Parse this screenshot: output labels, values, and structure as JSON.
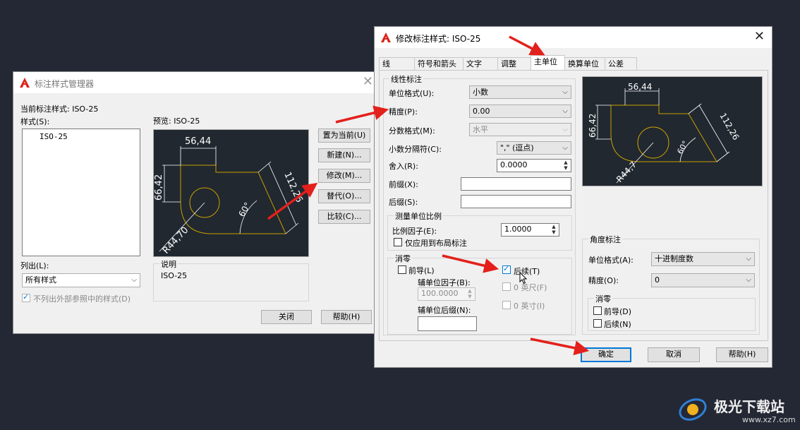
{
  "manager": {
    "title": "标注样式管理器",
    "current_style_label": "当前标注样式: ISO-25",
    "styles_label": "样式(S):",
    "styles": [
      "ISO-25"
    ],
    "preview_label": "预览: ISO-25",
    "list_label": "列出(L):",
    "list_value": "所有样式",
    "exclude_xref_label": "不列出外部参照中的样式(D)",
    "description_label": "说明",
    "description_value": "ISO-25",
    "buttons": {
      "set_current": "置为当前(U)",
      "new": "新建(N)...",
      "modify": "修改(M)...",
      "override": "替代(O)...",
      "compare": "比较(C)...",
      "close": "关闭",
      "help": "帮助(H)"
    },
    "preview_dims": {
      "width": "56,44",
      "height": "66,42",
      "diag": "112,26",
      "radius": "R44,70",
      "angle": "60°"
    }
  },
  "modify": {
    "title": "修改标注样式: ISO-25",
    "tabs": [
      "线",
      "符号和箭头",
      "文字",
      "调整",
      "主单位",
      "换算单位",
      "公差"
    ],
    "active_tab": "主单位",
    "linear": {
      "group_label": "线性标注",
      "unit_format_label": "单位格式(U):",
      "unit_format_value": "小数",
      "precision_label": "精度(P):",
      "precision_value": "0.00",
      "fraction_label": "分数格式(M):",
      "fraction_value": "水平",
      "decimal_sep_label": "小数分隔符(C):",
      "decimal_sep_value": "\",\" (逗点)",
      "round_label": "舍入(R):",
      "round_value": "0.0000",
      "prefix_label": "前缀(X):",
      "prefix_value": "",
      "suffix_label": "后缀(S):",
      "suffix_value": ""
    },
    "scale": {
      "group_label": "测量单位比例",
      "factor_label": "比例因子(E):",
      "factor_value": "1.0000",
      "layout_only_label": "仅应用到布局标注"
    },
    "zero": {
      "group_label": "消零",
      "leading_label": "前导(L)",
      "trailing_label": "后续(T)",
      "sub_factor_label": "辅单位因子(B):",
      "sub_factor_value": "100.0000",
      "sub_suffix_label": "辅单位后缀(N):",
      "sub_suffix_value": "",
      "feet_label": "0 英尺(F)",
      "inches_label": "0 英寸(I)"
    },
    "angular": {
      "group_label": "角度标注",
      "unit_format_label": "单位格式(A):",
      "unit_format_value": "十进制度数",
      "precision_label": "精度(O):",
      "precision_value": "0",
      "zero_label": "消零",
      "leading_label": "前导(D)",
      "trailing_label": "后续(N)"
    },
    "preview_dims": {
      "width": "56,44",
      "height": "66,42",
      "diag": "112,26",
      "radius": "R44,7",
      "angle": "60°"
    },
    "buttons": {
      "ok": "确定",
      "cancel": "取消",
      "help": "帮助(H)"
    }
  },
  "watermark": {
    "brand": "极光下载站",
    "url": "www.xz7.com"
  },
  "colors": {
    "desktop": "#232834",
    "accent": "#0078d7",
    "arrow": "#e3201b",
    "preview_bg": "#212830",
    "shape": "#c8a000"
  }
}
